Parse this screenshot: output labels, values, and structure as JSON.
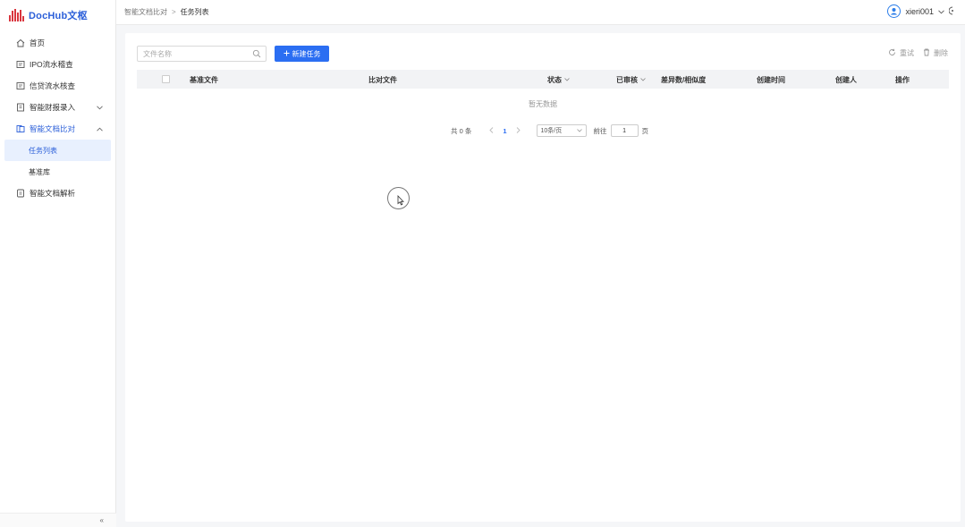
{
  "app": {
    "logo_text": "DocHub文枢",
    "logo_color": "#2b5fd9",
    "logo_mark_color": "#d9363e"
  },
  "sidebar": {
    "items": [
      {
        "label": "首页",
        "icon": "home-icon"
      },
      {
        "label": "IPO流水稽查",
        "icon": "ledger-icon"
      },
      {
        "label": "信贷流水核查",
        "icon": "ledger-icon"
      },
      {
        "label": "智能财报录入",
        "icon": "report-icon",
        "expandable": true
      },
      {
        "label": "智能文档比对",
        "icon": "compare-icon",
        "expanded": true,
        "children": [
          {
            "label": "任务列表",
            "active": true
          },
          {
            "label": "基准库"
          }
        ]
      },
      {
        "label": "智能文档解析",
        "icon": "parse-icon"
      }
    ],
    "collapse_glyph": "«"
  },
  "header": {
    "breadcrumb": {
      "parent": "智能文档比对",
      "separator": ">",
      "current": "任务列表"
    },
    "user": {
      "name": "xieri001"
    }
  },
  "toolbar": {
    "search_placeholder": "文件名称",
    "new_task_label": "新建任务",
    "reset_label": "重试",
    "delete_label": "删除"
  },
  "table": {
    "columns": [
      {
        "label": "基准文件"
      },
      {
        "label": "比对文件"
      },
      {
        "label": "状态",
        "sortable": true
      },
      {
        "label": "已审核",
        "sortable": true
      },
      {
        "label": "差异数/相似度"
      },
      {
        "label": "创建时间"
      },
      {
        "label": "创建人"
      },
      {
        "label": "操作"
      }
    ],
    "empty_text": "暂无数据"
  },
  "pagination": {
    "total_text": "共 0 条",
    "current_page": "1",
    "page_size": "10条/页",
    "goto_prefix": "前往",
    "goto_value": "1",
    "goto_suffix": "页"
  },
  "colors": {
    "primary": "#2b6ef2",
    "active_bg": "#e8f0fe"
  }
}
